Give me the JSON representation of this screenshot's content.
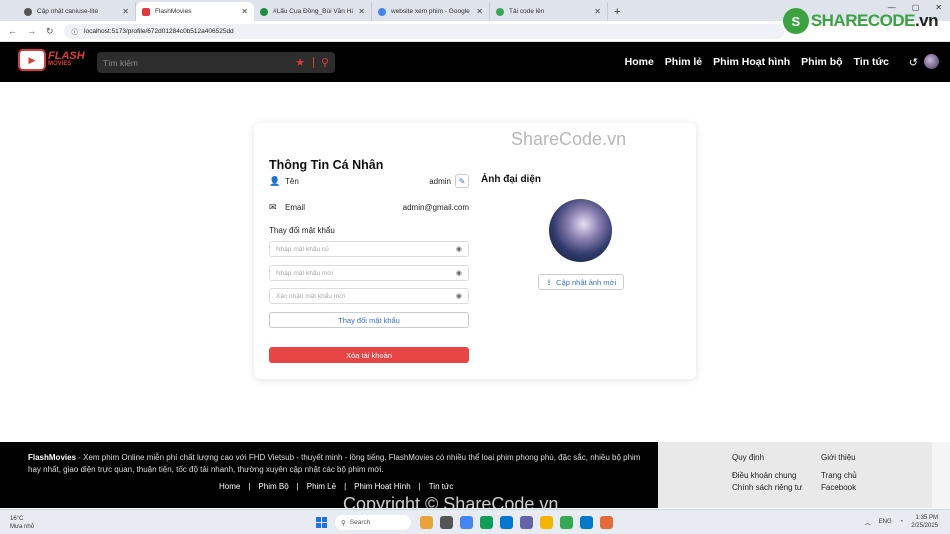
{
  "browser": {
    "tabs": [
      {
        "title": "Cập nhật caniuse-lite",
        "active": false
      },
      {
        "title": "FlashMovies",
        "active": true
      },
      {
        "title": "#Lẩu Cua Đồng_Bùi Văn Hải_Fi",
        "active": false
      },
      {
        "title": "website xem phim - Google Dr",
        "active": false
      },
      {
        "title": "Tải code lên",
        "active": false
      }
    ],
    "url": "localhost:5173/profile/672d01284c0b512a406525dd"
  },
  "sharecode_logo": {
    "text": "SHARECODE",
    "suffix": ".vn"
  },
  "header": {
    "brand_top": "FLASH",
    "brand_bottom": "MOVIES",
    "search_placeholder": "Tìm kiếm",
    "menu": [
      "Home",
      "Phim lẻ",
      "Phim Hoạt hình",
      "Phim bộ",
      "Tin tức"
    ]
  },
  "profile": {
    "watermark": "ShareCode.vn",
    "title": "Thông Tin Cá Nhân",
    "name_label": "Tên",
    "name_value": "admin",
    "email_label": "Email",
    "email_value": "admin@gmail.com",
    "password_section": "Thay đổi mật khẩu",
    "old_password_placeholder": "Nhập mật khẩu cũ",
    "new_password_placeholder": "Nhập mật khẩu mới",
    "confirm_password_placeholder": "Xác nhận mật khẩu mới",
    "change_password_button": "Thay đổi mật khẩu",
    "delete_account_button": "Xóa tài khoản",
    "avatar_title": "Ảnh đại diện",
    "update_avatar_button": "Cập nhật ảnh mới"
  },
  "footer": {
    "brand": "FlashMovies",
    "description": " - Xem phim Online miễn phí chất lượng cao với FHD Vietsub - thuyết minh - lồng tiếng. FlashMovies có nhiều thể loại phim phong phú, đặc sắc, nhiều bộ phim hay nhất, giao diện trực quan, thuận tiện, tốc độ tải nhanh, thường xuyên cập nhật các bộ phim mới.",
    "links": [
      "Home",
      "|",
      "Phim Bộ",
      "|",
      "Phim Lẻ",
      "|",
      "Phim Hoạt Hình",
      "|",
      "Tin tức"
    ],
    "col1": {
      "heading": "Quy định",
      "items": [
        "Điều khoản chung",
        "Chính sách riêng tư"
      ]
    },
    "col2": {
      "heading": "Giới thiệu",
      "items": [
        "Trang chủ",
        "Facebook"
      ]
    },
    "watermark": "Copyright © ShareCode.vn"
  },
  "taskbar": {
    "temperature": "16°C",
    "weather": "Mưa nhỏ",
    "search": "Search",
    "lang": "ENG",
    "time": "1:35 PM",
    "date": "2/25/2025"
  }
}
